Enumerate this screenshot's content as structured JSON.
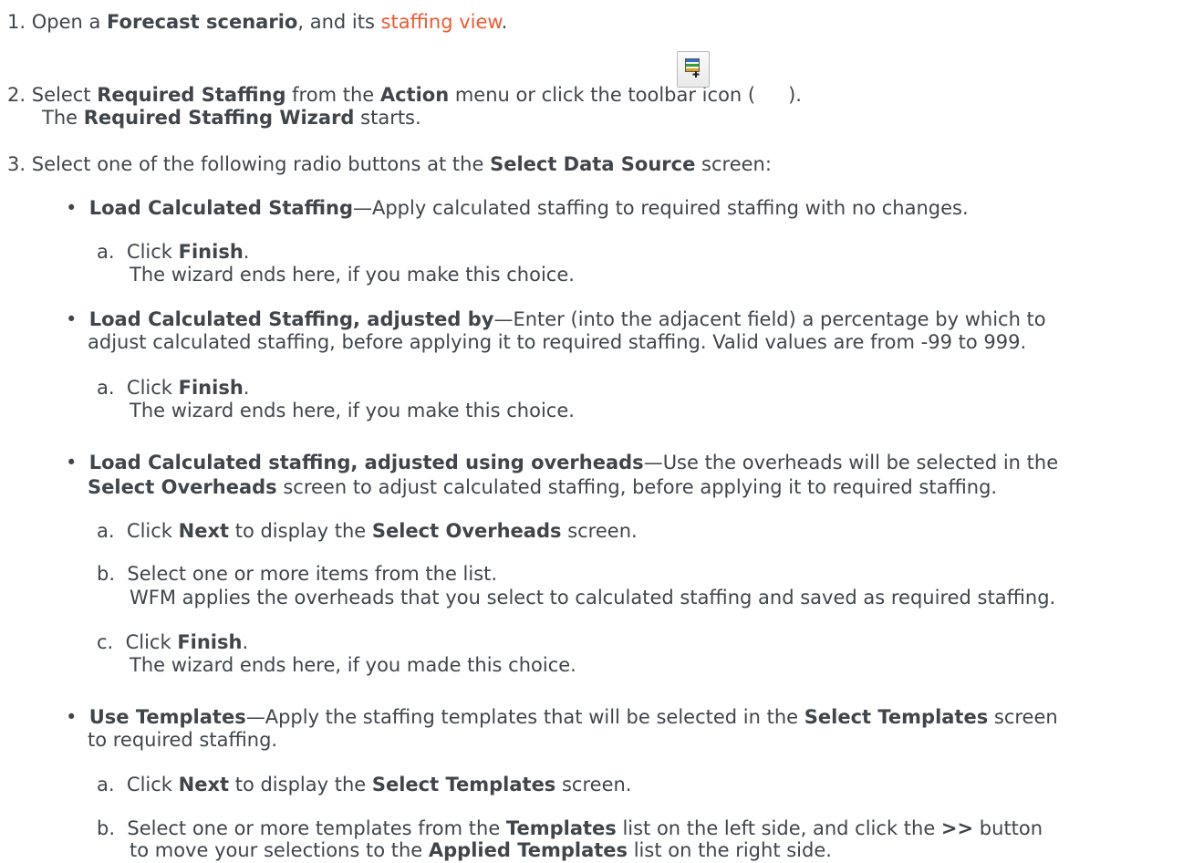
{
  "steps": {
    "s1": {
      "num": "1.",
      "t1": "Open a ",
      "b1": "Forecast scenario",
      "t2": ", and its ",
      "link": "staffing view",
      "t3": "."
    },
    "s2": {
      "num": "2.",
      "t1": "Select ",
      "b1": "Required Staffing",
      "t2": " from the ",
      "b2": "Action",
      "t3": " menu or click the toolbar icon (",
      "t4": ").",
      "icon": "required-staffing-toolbar-icon",
      "sub_t1": "The ",
      "sub_b1": "Required Staffing Wizard",
      "sub_t2": " starts."
    },
    "s3": {
      "num": "3.",
      "t1": "Select one of the following radio buttons at the ",
      "b1": "Select Data Source",
      "t2": " screen:",
      "bullets": [
        {
          "title": "Load Calculated Staffing",
          "desc": "—Apply calculated staffing to required staffing with no changes.",
          "a": {
            "n": "a.",
            "t1": "Click ",
            "b1": "Finish",
            "t2": ".",
            "sub": "The wizard ends here, if you make this choice."
          }
        },
        {
          "title": "Load Calculated Staffing, adjusted by",
          "desc": "—Enter (into the adjacent field) a percentage by which to",
          "desc2": "adjust calculated staffing, before applying it to required staffing. Valid values are from -99 to 999.",
          "a": {
            "n": "a.",
            "t1": "Click ",
            "b1": "Finish",
            "t2": ".",
            "sub": "The wizard ends here, if you make this choice."
          }
        },
        {
          "title": "Load Calculated staffing, adjusted using overheads",
          "desc": "—Use the overheads will be selected in the",
          "desc2_b": "Select Overheads",
          "desc2": " screen to adjust calculated staffing, before applying it to required staffing.",
          "a": {
            "n": "a.",
            "t1": "Click ",
            "b1": "Next",
            "t2": " to display the ",
            "b2": "Select Overheads",
            "t3": " screen."
          },
          "b": {
            "n": "b.",
            "t1": "Select one or more items from the list.",
            "sub": "WFM applies the overheads that you select to calculated staffing and saved as required staffing."
          },
          "c": {
            "n": "c.",
            "t1": "Click ",
            "b1": "Finish",
            "t2": ".",
            "sub": "The wizard ends here, if you made this choice."
          }
        },
        {
          "title": "Use Templates",
          "desc": "—Apply the staffing templates that will be selected in the ",
          "desc_b": "Select Templates",
          "desc_t": " screen",
          "desc2": "to required staffing.",
          "a": {
            "n": "a.",
            "t1": "Click ",
            "b1": "Next",
            "t2": " to display the ",
            "b2": "Select Templates",
            "t3": " screen."
          },
          "b": {
            "n": "b.",
            "t1": "Select one or more templates from the ",
            "b1": "Templates",
            "t2": " list on the left side, and click the ",
            "b2": ">>",
            "t3": " button",
            "l2_t1": "to move your selections to the ",
            "l2_b1": "Applied Templates",
            "l2_t2": " list on the right side."
          }
        }
      ]
    }
  }
}
